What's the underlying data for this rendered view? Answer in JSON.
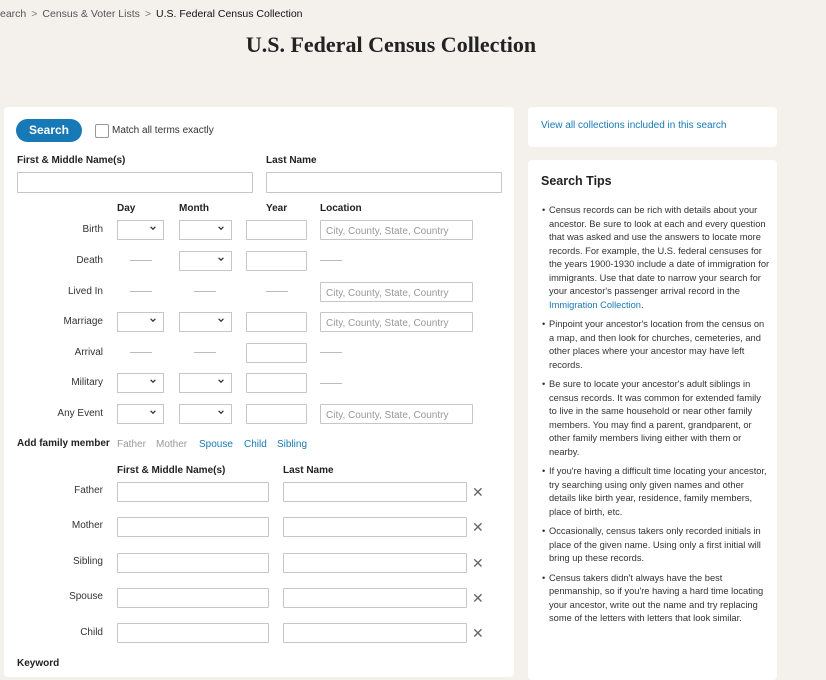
{
  "breadcrumb": {
    "items": [
      "earch",
      "Census & Voter Lists"
    ],
    "current": "U.S. Federal Census Collection"
  },
  "page_title": "U.S. Federal Census Collection",
  "search": {
    "button_label": "Search",
    "match_exact_label": "Match all terms exactly"
  },
  "name_fields": {
    "first_label": "First & Middle Name(s)",
    "last_label": "Last Name",
    "first_value": "",
    "last_value": ""
  },
  "event_headers": {
    "day": "Day",
    "month": "Month",
    "year": "Year",
    "location": "Location"
  },
  "events": [
    {
      "label": "Birth"
    },
    {
      "label": "Death"
    },
    {
      "label": "Lived In"
    },
    {
      "label": "Marriage"
    },
    {
      "label": "Arrival"
    },
    {
      "label": "Military"
    },
    {
      "label": "Any Event"
    }
  ],
  "location_placeholder": "City, County, State, Country",
  "family": {
    "add_label": "Add family member",
    "options": [
      "Father",
      "Mother",
      "Spouse",
      "Child",
      "Sibling"
    ],
    "first_header": "First & Middle Name(s)",
    "last_header": "Last Name",
    "rows": [
      "Father",
      "Mother",
      "Sibling",
      "Spouse",
      "Child"
    ],
    "remove_glyph": "✕"
  },
  "keyword_label": "Keyword",
  "sidebar": {
    "view_all_link": "View all collections included in this search",
    "tips_title": "Search Tips",
    "tips": [
      {
        "text": "Census records can be rich with details about your ancestor. Be sure to look at each and every question that was asked and use the answers to locate more records. For example, the U.S. federal censuses for the years 1900-1930 include a date of immigration for immigrants. Use that date to narrow your search for your ancestor's passenger arrival record in the ",
        "link": "Immigration Collection",
        "tail": "."
      },
      {
        "text": "Pinpoint your ancestor's location from the census on a map, and then look for churches, cemeteries, and other places where your ancestor may have left records."
      },
      {
        "text": "Be sure to locate your ancestor's adult siblings in census records. It was common for extended family to live in the same household or near other family members. You may find a parent, grandparent, or other family members living either with them or nearby."
      },
      {
        "text": "If you're having a difficult time locating your ancestor, try searching using only given names and other details like birth year, residence, family members, place of birth, etc."
      },
      {
        "text": "Occasionally, census takers only recorded initials in place of the given name. Using only a first initial will bring up these records."
      },
      {
        "text": "Census takers didn't always have the best penmanship, so if you're having a hard time locating your ancestor, write out the name and try replacing some of the letters with letters that look similar."
      }
    ]
  },
  "colors": {
    "accent": "#1779b5",
    "background": "#f4f1ed"
  },
  "icons": {
    "select": "chevron-down-icon",
    "remove": "close-icon"
  }
}
